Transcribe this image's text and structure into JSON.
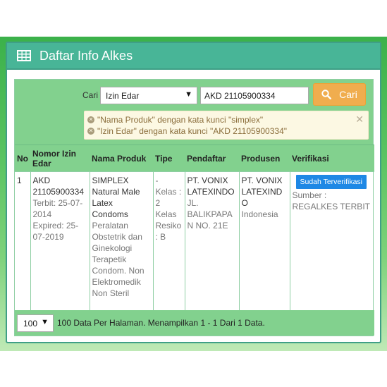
{
  "header": {
    "title": "Daftar Info Alkes",
    "icon": "table-grid-icon"
  },
  "search": {
    "label": "Cari",
    "select_value": "Izin Edar",
    "input_value": "AKD 21105900334",
    "button_label": "Cari"
  },
  "filters": [
    "\"Nama Produk\" dengan kata kunci \"simplex\"",
    "\"Izin Edar\" dengan kata kunci \"AKD 21105900334\""
  ],
  "table": {
    "headers": [
      "No",
      "Nomor Izin Edar",
      "Nama Produk",
      "Tipe",
      "Pendaftar",
      "Produsen",
      "Verifikasi"
    ],
    "row": {
      "no": "1",
      "izin_number": "AKD 21105900334",
      "izin_terbit": "Terbit: 25-07-2014",
      "izin_expired": "Expired: 25-07-2019",
      "produk_name": "SIMPLEX Natural Male Latex Condoms",
      "produk_desc": "Peralatan Obstetrik dan Ginekologi Terapetik Condom. Non Elektromedik Non Steril",
      "tipe_dash": "-",
      "tipe_kelas": "Kelas : 2",
      "tipe_resiko": "Kelas Resiko : B",
      "pendaftar_name": "PT. VONIX LATEXINDO",
      "pendaftar_addr": "JL. BALIKPAPAN NO. 21E",
      "produsen_name": "PT. VONIX LATEXINDO",
      "produsen_country": "Indonesia",
      "verifikasi_badge": "Sudah Terverifikasi",
      "verifikasi_source": "Sumber : REGALKES TERBIT"
    }
  },
  "footer": {
    "perpage_value": "100",
    "summary": "100 Data Per Halaman. Menampilkan 1 - 1 Dari 1 Data."
  },
  "colors": {
    "header_bg": "#48b597",
    "green_bar": "#82d18e",
    "button_orange": "#f0ad4e",
    "badge_blue": "#1e88e5"
  }
}
